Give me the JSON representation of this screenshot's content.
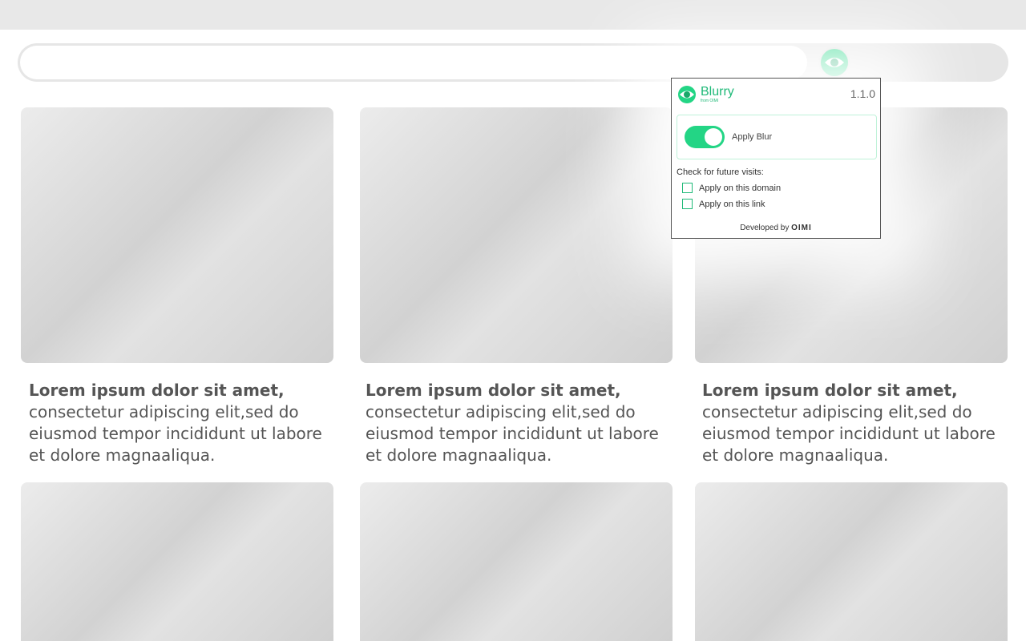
{
  "browser": {
    "address_value": "",
    "extension_icon": "eye-icon"
  },
  "cards": [
    {
      "title": "Lorem ipsum dolor sit amet,",
      "body": "consectetur adipiscing elit,sed do eiusmod tempor incididunt ut labore et dolore magnaaliqua."
    },
    {
      "title": "Lorem ipsum dolor sit amet,",
      "body": "consectetur adipiscing elit,sed do eiusmod tempor incididunt ut labore et dolore magnaaliqua."
    },
    {
      "title": "Lorem ipsum dolor sit amet,",
      "body": "consectetur adipiscing elit,sed do eiusmod tempor incididunt ut labore et dolore magnaaliqua."
    }
  ],
  "popup": {
    "brand": "Blurry",
    "brand_sub": "from OIMI",
    "version": "1.1.0",
    "toggle_label": "Apply Blur",
    "toggle_on": true,
    "check_title": "Check for future visits:",
    "options": [
      {
        "label": "Apply on this domain",
        "checked": false
      },
      {
        "label": "Apply on this link",
        "checked": false
      }
    ],
    "footer_prefix": "Developed by",
    "footer_brand": "OIMI"
  },
  "colors": {
    "accent": "#23d585",
    "text_gray": "#555555"
  }
}
